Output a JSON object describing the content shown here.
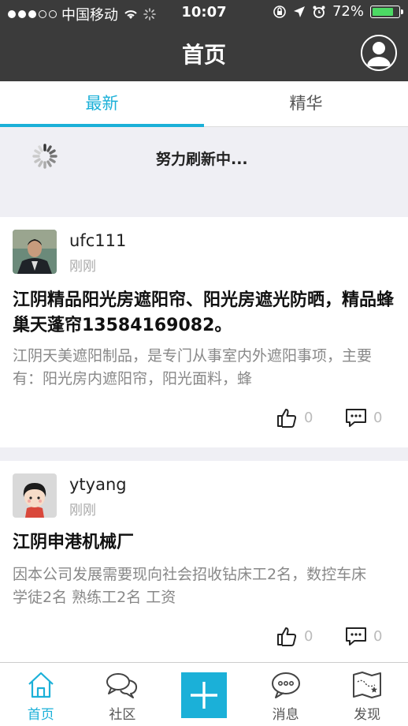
{
  "status_bar": {
    "carrier": "中国移动",
    "time": "10:07",
    "battery": "72%",
    "battery_level": 0.72,
    "signal_bars": 3
  },
  "header": {
    "title": "首页"
  },
  "tabs": [
    {
      "label": "最新",
      "active": true
    },
    {
      "label": "精华",
      "active": false
    }
  ],
  "refresh": {
    "text": "努力刷新中..."
  },
  "posts": [
    {
      "username": "ufc111",
      "time": "刚刚",
      "title": "江阴精品阳光房遮阳帘、阳光房遮光防晒，精品蜂巢天蓬帘13584169082。",
      "excerpt": "江阴天美遮阳制品，是专门从事室内外遮阳事项，主要有：阳光房内遮阳帘，阳光面料，蜂",
      "likes": "0",
      "comments": "0"
    },
    {
      "username": "ytyang",
      "time": "刚刚",
      "title": "江阴申港机械厂",
      "excerpt": "因本公司发展需要现向社会招收钻床工2名，数控车床学徒2名  熟练工2名  工资",
      "likes": "0",
      "comments": "0"
    }
  ],
  "tabbar": {
    "items": [
      {
        "label": "首页",
        "icon": "home-icon",
        "active": true
      },
      {
        "label": "社区",
        "icon": "chat-bubbles-icon"
      },
      {
        "label": "",
        "icon": "plus-icon"
      },
      {
        "label": "消息",
        "icon": "message-icon"
      },
      {
        "label": "发现",
        "icon": "map-icon"
      }
    ]
  },
  "colors": {
    "accent": "#1bb0d8",
    "header_bg": "#3b3b3b"
  }
}
